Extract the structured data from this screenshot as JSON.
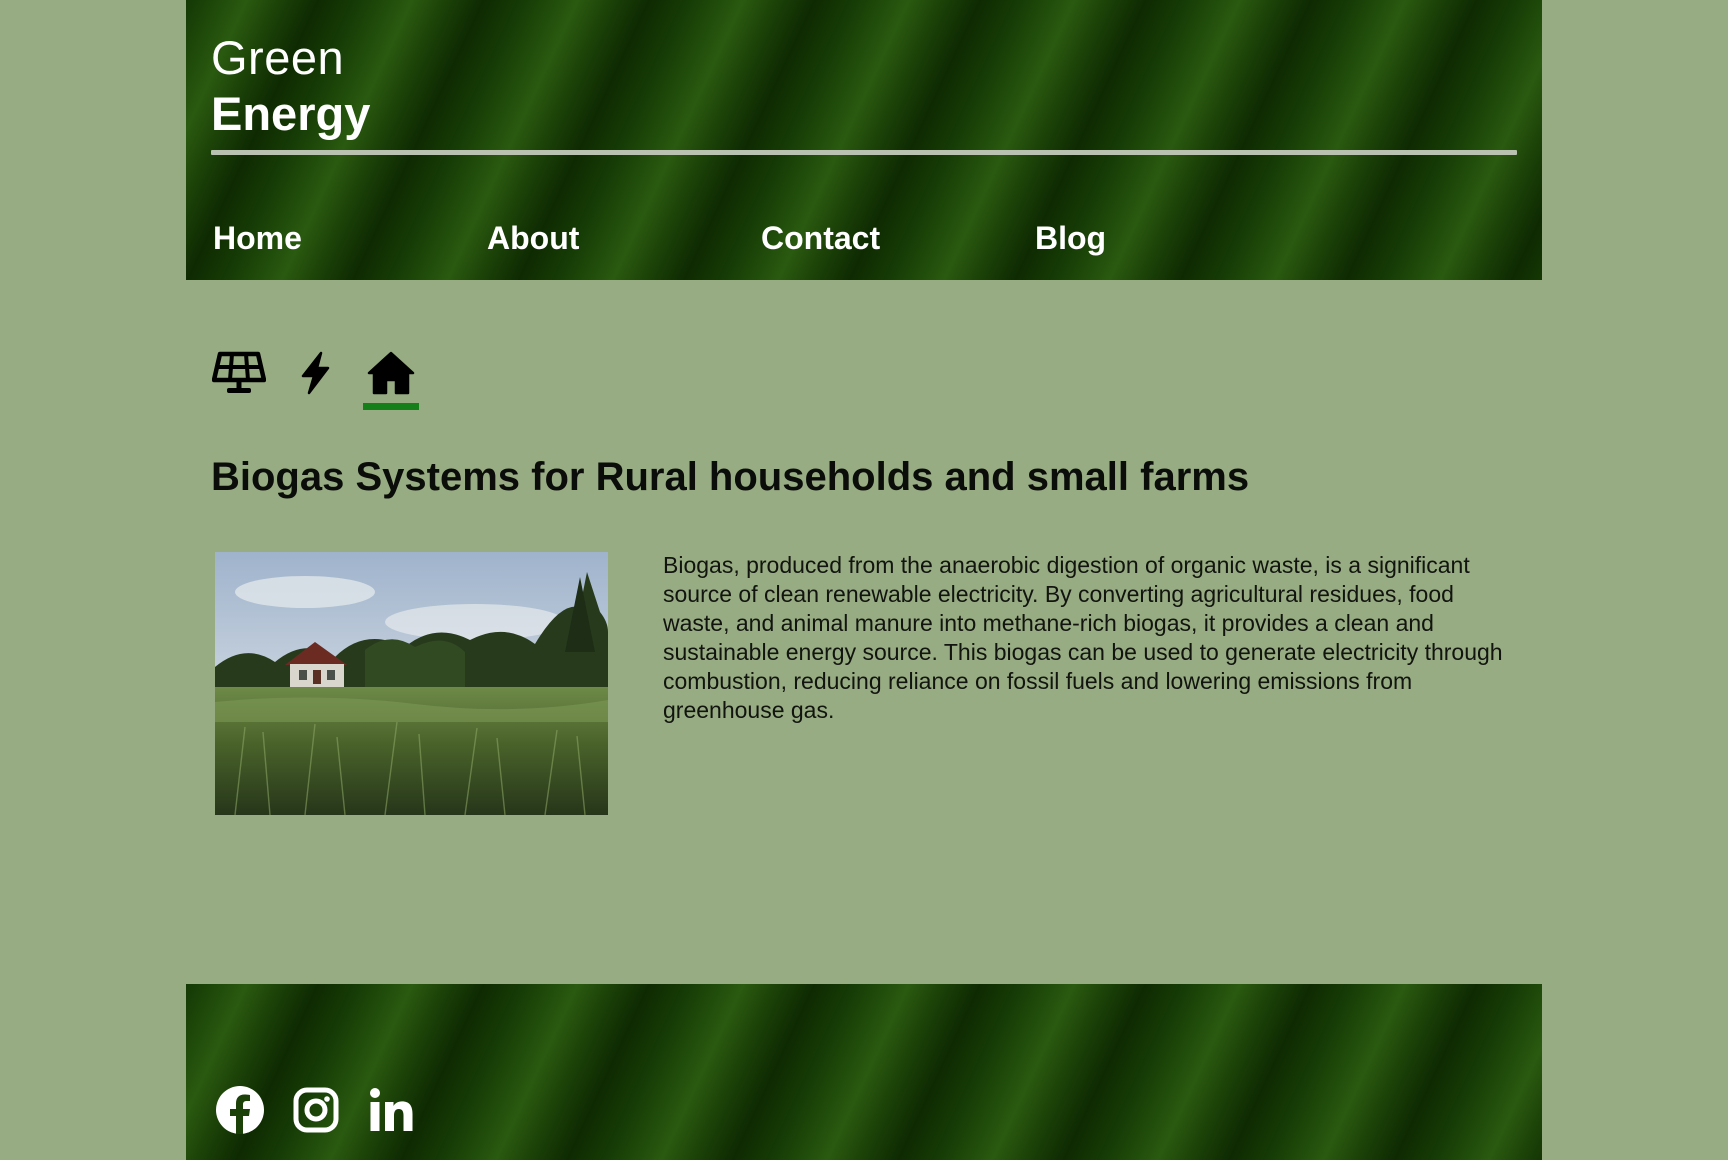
{
  "brand": {
    "line1": "Green",
    "line2": "Energy"
  },
  "nav": {
    "items": [
      {
        "label": "Home"
      },
      {
        "label": "About"
      },
      {
        "label": "Contact"
      },
      {
        "label": "Blog"
      }
    ]
  },
  "category_icons": [
    {
      "icon": "solar-panel-icon",
      "active": false
    },
    {
      "icon": "lightning-bolt-icon",
      "active": false
    },
    {
      "icon": "house-icon",
      "active": true
    }
  ],
  "article": {
    "title": "Biogas Systems for Rural households and small farms",
    "body": "Biogas, produced from the anaerobic digestion of organic waste, is a significant source of clean renewable electricity. By converting agricultural residues, food waste, and animal manure into methane-rich biogas, it provides a clean and sustainable energy source. This biogas can be used to generate electricity through combustion, reducing reliance on fossil fuels and lowering emissions from greenhouse gas."
  },
  "footer": {
    "social": [
      {
        "icon": "facebook-icon"
      },
      {
        "icon": "instagram-icon"
      },
      {
        "icon": "linkedin-icon"
      }
    ]
  },
  "colors": {
    "page_background": "#97ac82",
    "banner_green": "#1a3d06",
    "active_indicator": "#15801a",
    "text_light": "#ffffff",
    "text_dark": "#0b0d0a"
  }
}
